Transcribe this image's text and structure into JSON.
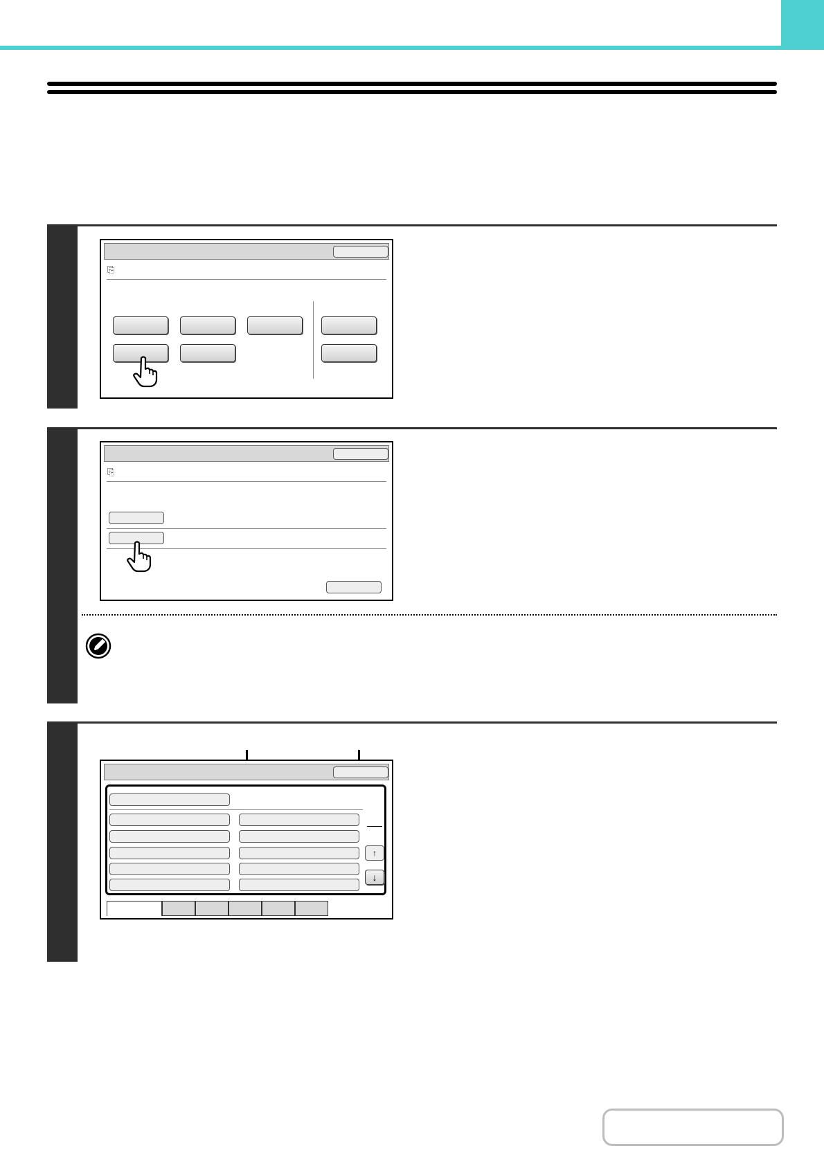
{
  "header": {
    "accent_color": "#4ecfcf",
    "page_title": "",
    "intro_text": ""
  },
  "steps": [
    {
      "number": ""
    },
    {
      "number": ""
    },
    {
      "number": ""
    }
  ],
  "page_indicator": {
    "text": ""
  },
  "colors": {
    "step_bar": "#2f2f2f",
    "panel_title": "#d8d8d8",
    "button_face": "#e6e6e6"
  }
}
